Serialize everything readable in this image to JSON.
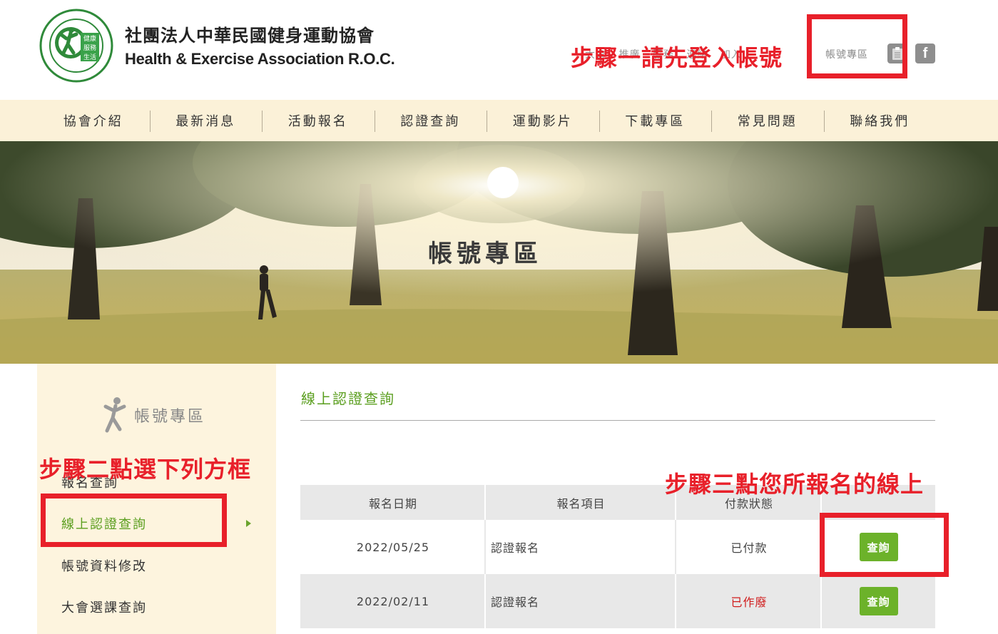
{
  "header": {
    "org_name_zh": "社團法人中華民國健身運動協會",
    "org_name_en": "Health & Exercise Association R.O.C.",
    "top_links": [
      "大會",
      "推廣",
      "服務",
      "連結",
      "加入"
    ],
    "account_link": "帳號專區",
    "icons": [
      "clipboard-icon",
      "facebook-icon"
    ],
    "logo_badge": [
      "健康",
      "服務",
      "生活"
    ]
  },
  "nav": {
    "items": [
      "協會介紹",
      "最新消息",
      "活動報名",
      "認證查詢",
      "運動影片",
      "下載專區",
      "常見問題",
      "聯絡我們"
    ]
  },
  "banner": {
    "title": "帳號專區"
  },
  "sidebar": {
    "title": "帳號專區",
    "items": [
      "報名查詢",
      "線上認證查詢",
      "帳號資料修改",
      "大會選課查詢"
    ],
    "active_index": 1
  },
  "main": {
    "title": "線上認證查詢",
    "table": {
      "headers": [
        "報名日期",
        "報名項目",
        "付款狀態",
        ""
      ],
      "rows": [
        {
          "date": "2022/05/25",
          "item": "認證報名",
          "status": "已付款",
          "action": "查詢"
        },
        {
          "date": "2022/02/11",
          "item": "認證報名",
          "status": "已作廢",
          "action": "查詢"
        }
      ]
    }
  },
  "annotations": {
    "step1": "步驟一請先登入帳號",
    "step2": "步驟二點選下列方框",
    "step3": "步驟三點您所報名的線上"
  },
  "colors": {
    "accent_green": "#5a9e1e",
    "button_green": "#6cb22a",
    "annotation_red": "#e8202a",
    "nav_bg": "#fbf1d8",
    "sidebar_bg": "#fdf4de",
    "void_red": "#d01c1c"
  }
}
